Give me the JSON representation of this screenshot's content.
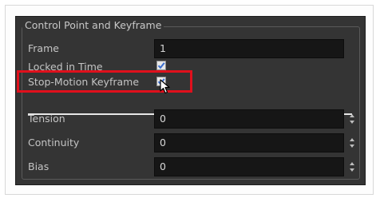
{
  "group": {
    "title": "Control Point and Keyframe"
  },
  "frame": {
    "label": "Frame",
    "value": "1"
  },
  "locked_in_time": {
    "label": "Locked in Time",
    "checked": true
  },
  "stop_motion_keyframe": {
    "label": "Stop-Motion Keyframe",
    "checked": true
  },
  "tension": {
    "label": "Tension",
    "value": "0"
  },
  "continuity": {
    "label": "Continuity",
    "value": "0"
  },
  "bias": {
    "label": "Bias",
    "value": "0"
  },
  "icons": {
    "checkmark": "checkmark-icon",
    "spin_arrows": "spin-arrows-icon",
    "cursor": "mouse-pointer-icon"
  },
  "colors": {
    "panel_bg": "#343434",
    "field_bg": "#161616",
    "highlight": "#e0101c",
    "check_blue": "#3c6fd0"
  }
}
